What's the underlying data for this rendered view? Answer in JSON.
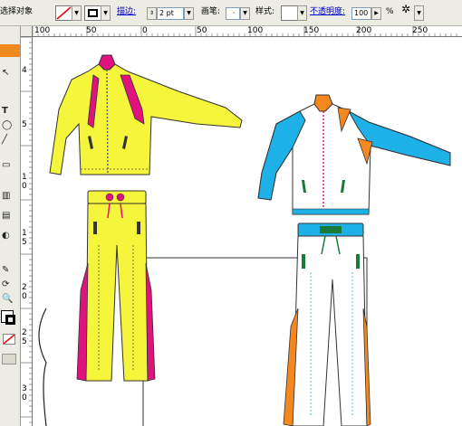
{
  "control_bar": {
    "selection_label": "选择对象",
    "stroke_label": "描边:",
    "stroke_weight": "2 pt",
    "brush_label": "画笔:",
    "style_label": "样式:",
    "opacity_label": "不透明度:",
    "opacity_value": "100",
    "percent": "%"
  },
  "ruler": {
    "h_labels": [
      "100",
      "50",
      "0",
      "50",
      "100",
      "150",
      "200",
      "250"
    ],
    "v_labels": [
      "4",
      "5",
      "1",
      "0",
      "1",
      "5",
      "2",
      "0",
      "2",
      "5",
      "3",
      "0"
    ]
  },
  "toolbox": {
    "tool_glyphs": [
      "↖",
      "T",
      "◯",
      "╱",
      "▭",
      "▥",
      "▤",
      "◐",
      "✎",
      "◇",
      "⟳",
      "✋",
      "🔍"
    ]
  },
  "artwork": {
    "jacket_left_colors": {
      "body": "#f5f53b",
      "accent": "#e0137e"
    },
    "jacket_right_colors": {
      "body": "#ffffff",
      "sleeve": "#1eb1e8",
      "accent": "#f5871f"
    }
  }
}
